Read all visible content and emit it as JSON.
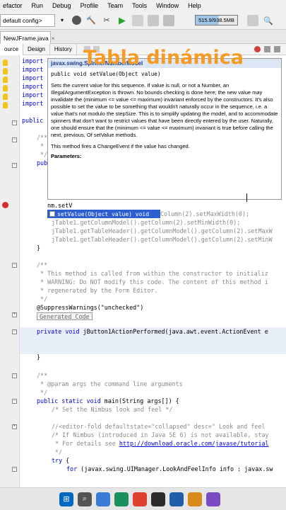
{
  "menubar": [
    "efactor",
    "Run",
    "Debug",
    "Profile",
    "Team",
    "Tools",
    "Window",
    "Help"
  ],
  "toolbar": {
    "config": "default config>",
    "memory": "515.9/938.5MB"
  },
  "file_tab": {
    "name": "NewJFrame.java",
    "close": "×"
  },
  "editor_tools": [
    "ource",
    "Design",
    "History"
  ],
  "overlay_title": "Tabla dinámica",
  "javadoc": {
    "header": "javax.swing.SpinnerNumberModel",
    "signature": "public void setValue(Object value)",
    "p1": "Sets the current value for this sequence. If value is null, or not a Number, an IllegalArgumentException is thrown. No bounds checking is done here; the new value may invalidate the (minimum <= value <= maximum) invariant enforced by the constructors. It's also possible to set the value to be something that wouldn't naturally occur in the sequence, i.e. a value that's not modulo the stepSize. This is to simplify updating the model, and to accommodate spinners that don't want to restrict values that have been directly entered by the user. Naturally, one should ensure that the (minimum <= value <= maximum) invariant is true before calling the next, previous, Of setValue methods.",
    "p2": "This method fires a ChangeEvent if the value has changed.",
    "params": "Parameters:"
  },
  "completion": "setValue(Object value) void",
  "code": {
    "l1": "import",
    "l2": "import",
    "l3": "import",
    "l4": "import",
    "l5": "import",
    "l6": "import",
    "l7": "public cl",
    "l8": "/**",
    "l9": " *",
    "l10": " */",
    "l11": "publ",
    "l12": "nm.setV",
    "l13": "Column(2).setMaxWidth(0);",
    "l14": "jTable1.getColumnModel().getColumn(2).setMinWidth(0);",
    "l15": "jTable1.getTableHeader().getColumnModel().getColumn(2).setMaxW",
    "l16": "jTable1.getTableHeader().getColumnModel().getColumn(2).setMinW",
    "l17": "}",
    "l18": "/**",
    "l19": " * This method is called from within the constructor to initializ",
    "l20": " * WARNING: Do NOT modify this code. The content of this method i",
    "l21": " * regenerated by the Form Editor.",
    "l22": " */",
    "l23": "@SuppressWarnings(\"unchecked\")",
    "l24": "Generated Code",
    "l25_kw": "private void",
    "l25_rest": " jButton1ActionPerformed(java.awt.event.ActionEvent e",
    "l26": "}",
    "l27": "/**",
    "l28": " * @param args the command line arguments",
    "l29": " */",
    "l30_kw": "public static void",
    "l30_rest": " main(String args[]) {",
    "l31": "/* Set the Nimbus look and feel */",
    "l32": "//<editor-fold defaultstate=\"collapsed\" desc=\" Look and feel",
    "l33": "/* If Nimbus (introduced in Java SE 6) is not available, stay",
    "l34_a": " * For details see ",
    "l34_link": "http://download.oracle.com/javase/tutorial",
    "l35": " */",
    "l36_kw": "try",
    "l36_rest": " {",
    "l37_kw": "for",
    "l37_rest": " (javax.swing.UIManager.LookAndFeelInfo info : javax.sw"
  },
  "colors": {
    "accent_title": "#f59a23",
    "keyword": "#0000e6",
    "comment": "#8a8a8a",
    "selection": "#2e5fd1"
  }
}
